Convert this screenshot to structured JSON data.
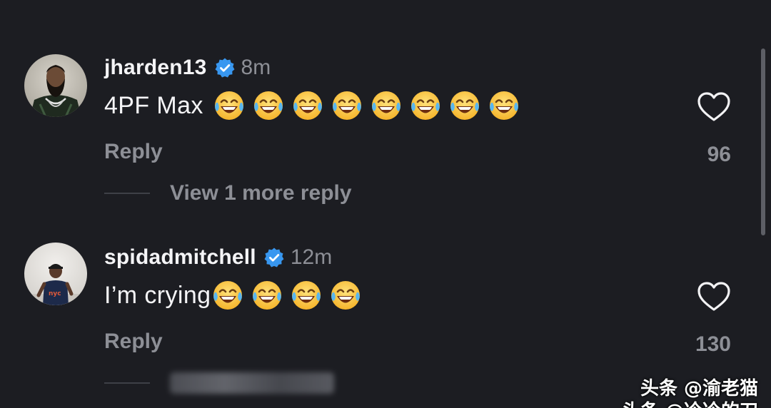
{
  "comments": [
    {
      "username": "jharden13",
      "verified": true,
      "time": "8m",
      "text": "4PF Max",
      "emoji_icon": "laughing-tears-emoji",
      "emoji_count": 8,
      "reply_label": "Reply",
      "likes": "96",
      "view_more": "View 1 more reply",
      "avatar": "avatar-bearded-man"
    },
    {
      "username": "spidadmitchell",
      "verified": true,
      "time": "12m",
      "text": "I’m crying",
      "emoji_icon": "laughing-tears-emoji",
      "emoji_count": 4,
      "reply_label": "Reply",
      "likes": "130",
      "avatar": "avatar-child-jersey"
    }
  ],
  "watermark": {
    "line1": "头条 @渝老猫",
    "line2": "头条 @冷冷的刀"
  },
  "colors": {
    "background": "#1c1d22",
    "verified": "#3897f0",
    "muted": "#8d8f96",
    "text": "#f4f4f6"
  }
}
